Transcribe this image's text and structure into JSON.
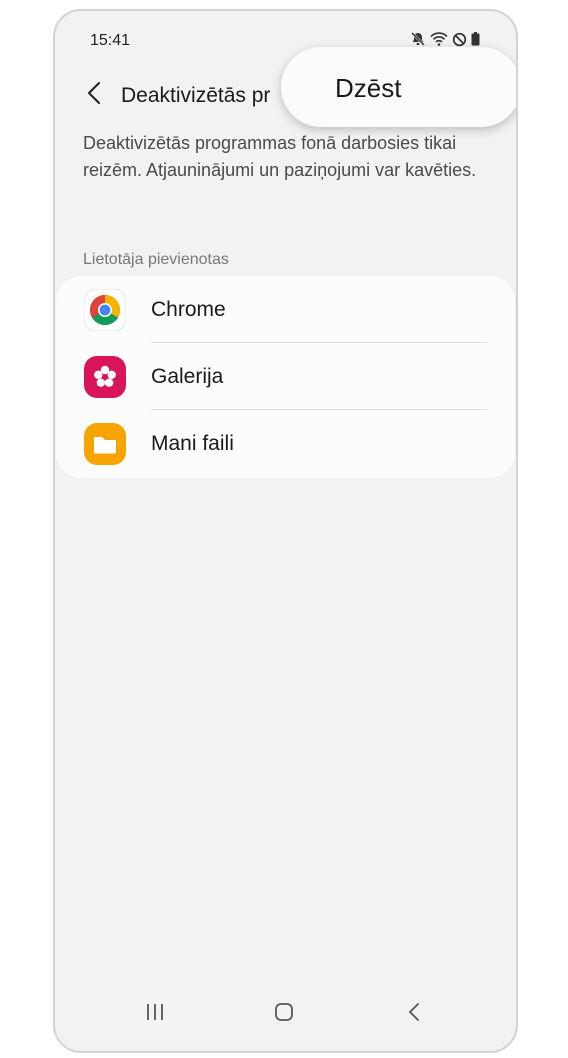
{
  "status_bar": {
    "time": "15:41",
    "icons": [
      "mute-icon",
      "wifi-icon",
      "do-not-disturb-icon",
      "battery-icon"
    ]
  },
  "header": {
    "title": "Deaktivizētās pr",
    "back_icon": "back-chevron-icon"
  },
  "popup_menu": {
    "delete_label": "Dzēst"
  },
  "description": "Deaktivizētās programmas fonā darbosies tikai reizēm. Atjauninājumi un paziņojumi var kavēties.",
  "section": {
    "label": "Lietotāja pievienotas",
    "apps": [
      {
        "name": "Chrome",
        "icon": "chrome-icon"
      },
      {
        "name": "Galerija",
        "icon": "gallery-icon"
      },
      {
        "name": "Mani faili",
        "icon": "my-files-icon"
      }
    ]
  },
  "nav_bar": {
    "buttons": [
      "recents-icon",
      "home-icon",
      "back-icon"
    ]
  },
  "colors": {
    "background": "#f2f2f2",
    "card": "#fcfcfc",
    "gallery": "#d8155a",
    "files": "#f7a400"
  }
}
